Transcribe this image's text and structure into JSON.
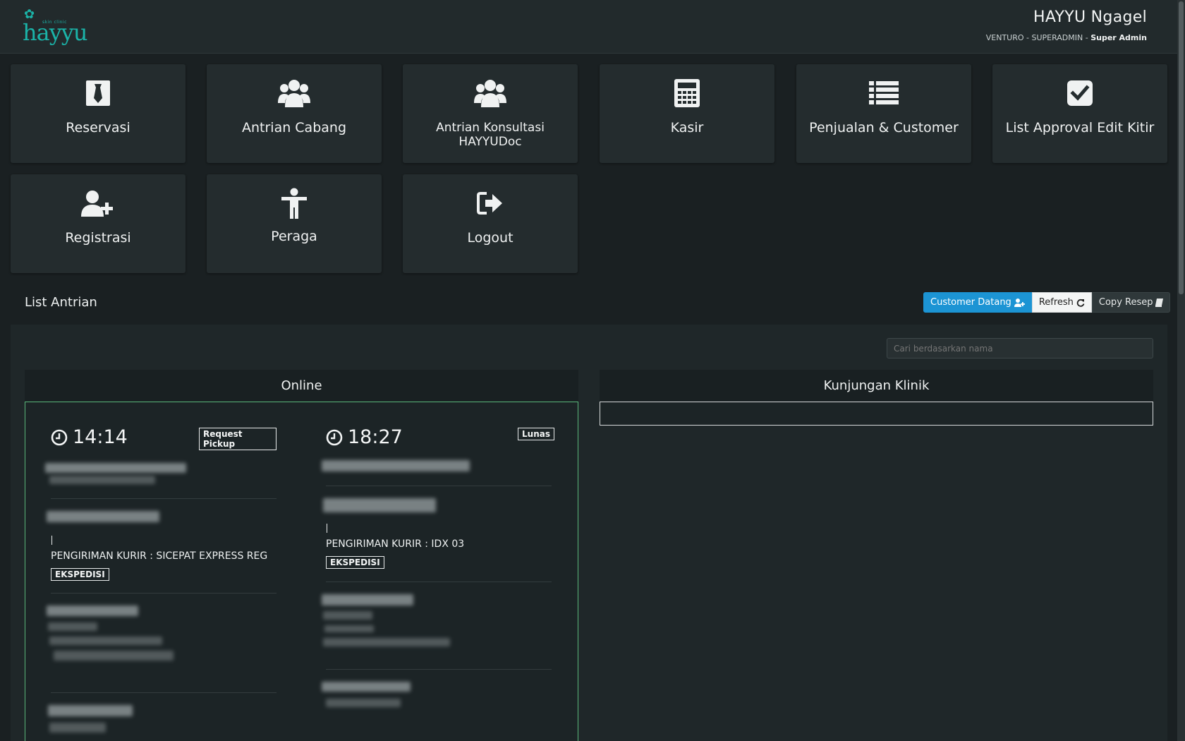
{
  "header": {
    "logo_text": "hayyu",
    "logo_tagline": "skin clinic",
    "title": "HAYYU Ngagel",
    "subtitle_prefix": "VENTURO - SUPERADMIN - ",
    "subtitle_role": "Super Admin"
  },
  "menu": [
    {
      "label": "Reservasi",
      "icon": "tie-icon"
    },
    {
      "label": "Antrian Cabang",
      "icon": "users-icon"
    },
    {
      "label": "Antrian Konsultasi HAYYUDoc",
      "icon": "users-icon"
    },
    {
      "label": "Kasir",
      "icon": "calculator-icon"
    },
    {
      "label": "Penjualan & Customer",
      "icon": "list-icon"
    },
    {
      "label": "List Approval Edit Kitir",
      "icon": "check-square-icon"
    },
    {
      "label": "Registrasi",
      "icon": "user-plus-icon"
    },
    {
      "label": "Peraga",
      "icon": "child-icon"
    },
    {
      "label": "Logout",
      "icon": "sign-out-icon"
    }
  ],
  "queue": {
    "title": "List Antrian",
    "buttons": {
      "customer_datang": "Customer Datang",
      "refresh": "Refresh",
      "copy_resep": "Copy Resep"
    },
    "search_placeholder": "Cari berdasarkan nama",
    "columns": {
      "online": "Online",
      "klinik": "Kunjungan Klinik"
    },
    "cards": [
      {
        "time": "14:14",
        "badge": "Request Pickup",
        "shipping": "PENGIRIMAN KURIR : SICEPAT EXPRESS REG",
        "tag": "EKSPEDISI"
      },
      {
        "time": "18:27",
        "badge": "Lunas",
        "shipping": "PENGIRIMAN KURIR : IDX 03",
        "tag": "EKSPEDISI"
      }
    ]
  },
  "colors": {
    "accent": "#1bb3a8",
    "primary_button": "#1c94d4",
    "online_border": "#5ab87a",
    "background": "#1a2022"
  }
}
